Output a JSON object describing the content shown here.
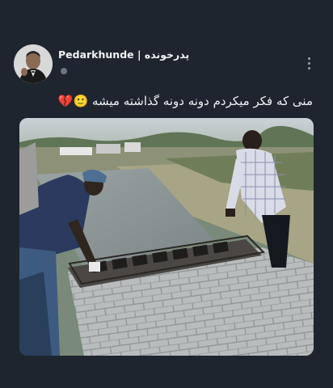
{
  "post": {
    "author_name": "Pedarkhunde | پدرخونده",
    "caption": "منی که فکر میکردم دونه دونه گذاشته میشه 🙂💔",
    "menu_icon": "more-vertical-icon",
    "media_description_icon": "photo-image"
  },
  "colors": {
    "background": "#1e252e",
    "text": "#e8ebee",
    "menu": "#9aa3ad"
  }
}
